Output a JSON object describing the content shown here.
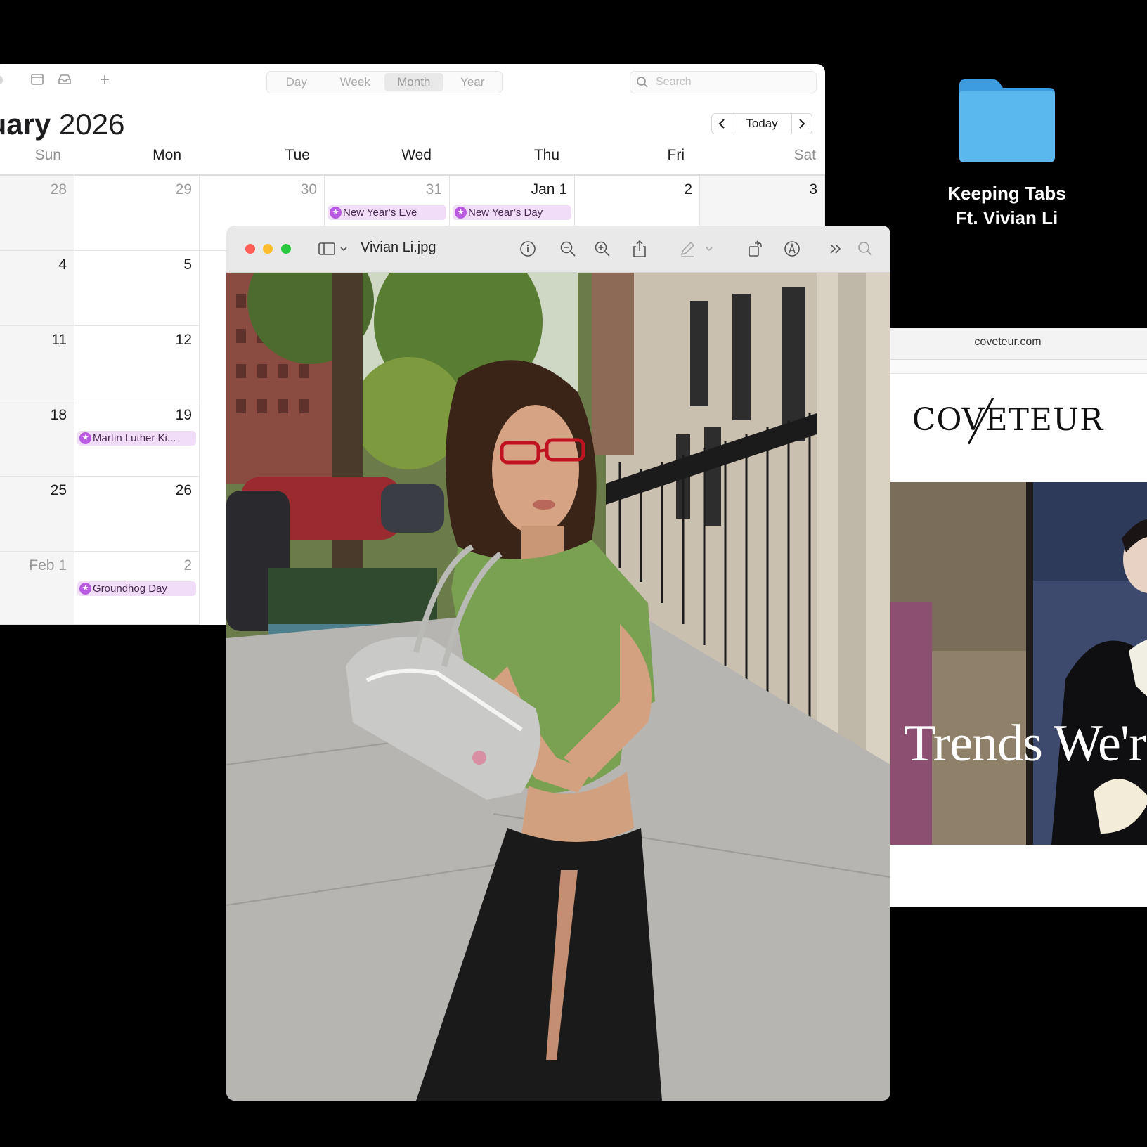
{
  "calendar": {
    "views": [
      "Day",
      "Week",
      "Month",
      "Year"
    ],
    "active_view": "Month",
    "search_placeholder": "Search",
    "title_month": "nuary",
    "title_year": "2026",
    "today_label": "Today",
    "weekdays": [
      "Sun",
      "Mon",
      "Tue",
      "Wed",
      "Thu",
      "Fri",
      "Sat"
    ],
    "row1": [
      "28",
      "29",
      "30",
      "31",
      "Jan 1",
      "2",
      "3"
    ],
    "row2": [
      "4",
      "5"
    ],
    "row3": [
      "11",
      "12"
    ],
    "row4": [
      "18",
      "19"
    ],
    "row5": [
      "25",
      "26"
    ],
    "row6": [
      "Feb 1",
      "2"
    ],
    "events": {
      "new_years_eve": "New Year’s Eve",
      "new_years_day": "New Year’s Day",
      "mlk_day": "Martin Luther Ki...",
      "groundhog_day": "Groundhog Day"
    },
    "event_color": "#b85be0"
  },
  "desktop": {
    "folder_line1": "Keeping Tabs",
    "folder_line2": "Ft. Vivian Li",
    "folder_color": "#5bb8ef"
  },
  "safari": {
    "url": "coveteur.com",
    "logo": "COVETEUR",
    "headline": "Trends We'r"
  },
  "preview": {
    "filename": "Vivian Li.jpg"
  }
}
